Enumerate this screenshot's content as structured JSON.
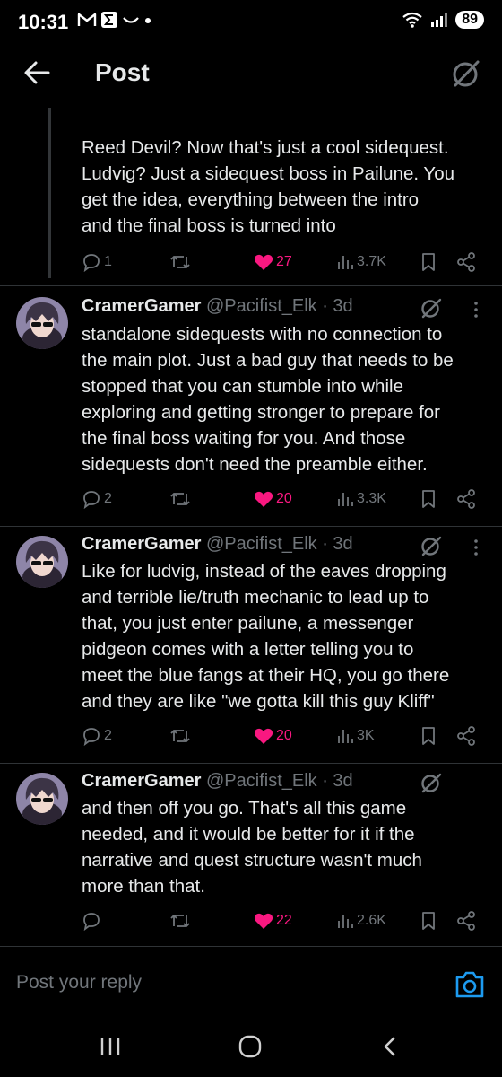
{
  "status_bar": {
    "time": "10:31",
    "battery": "89",
    "icons_left": [
      "gmail-icon",
      "messaging-icon",
      "wave-icon",
      "dot-icon"
    ],
    "icons_right": [
      "wifi-icon",
      "signal-icon",
      "battery-icon"
    ]
  },
  "header": {
    "title": "Post"
  },
  "parent_post": {
    "text_lines": [
      "Reed Devil? Now that's just a cool sidequest.",
      "Ludvig? Just a sidequest boss in Pailune. You",
      "get the idea, everything between the intro",
      "and the final boss is turned into"
    ],
    "stats": {
      "replies": "1",
      "likes": "27",
      "views": "3.7K"
    }
  },
  "replies": [
    {
      "author": "CramerGamer",
      "handle": "@Pacifist_Elk",
      "time": "· 3d",
      "text_lines": [
        "standalone sidequests with no connection to",
        "the main plot. Just a bad guy that needs to be",
        "stopped that you can stumble into while",
        "exploring and getting stronger to prepare for",
        "the final boss waiting for you. And those",
        "sidequests don't need the preamble either."
      ],
      "stats": {
        "replies": "2",
        "likes": "20",
        "views": "3.3K"
      }
    },
    {
      "author": "CramerGamer",
      "handle": "@Pacifist_Elk",
      "time": "· 3d",
      "text_lines": [
        "Like for ludvig, instead of the eaves dropping",
        "and terrible lie/truth mechanic to lead up to",
        "that, you just enter pailune, a messenger",
        "pidgeon comes with a letter telling you to",
        "meet the blue fangs at their HQ, you go there",
        "and they are like \"we gotta kill this guy Kliff\""
      ],
      "stats": {
        "replies": "2",
        "likes": "20",
        "views": "3K"
      }
    },
    {
      "author": "CramerGamer",
      "handle": "@Pacifist_Elk",
      "time": "· 3d",
      "text_lines": [
        "and then off you go. That's all this game",
        "needed, and it would be better for it if the",
        "narrative and quest structure wasn't much",
        "more than that."
      ],
      "stats": {
        "replies": "",
        "likes": "22",
        "views": "2.6K"
      }
    }
  ],
  "composer": {
    "placeholder": "Post your reply"
  },
  "colors": {
    "background": "#000000",
    "text": "#e7e9ea",
    "muted": "#71767b",
    "like": "#f91880",
    "accent": "#1d9bf0",
    "divider": "#2f3336"
  }
}
